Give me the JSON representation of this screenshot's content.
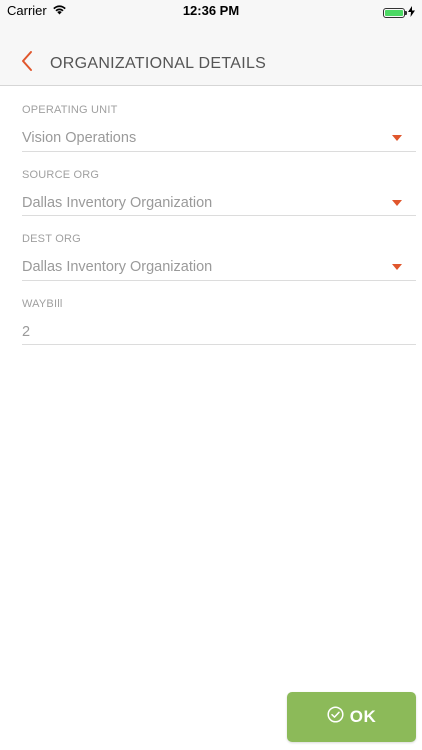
{
  "status_bar": {
    "carrier": "Carrier",
    "time": "12:36 PM",
    "icons": [
      "wifi-icon",
      "battery-icon",
      "charging-bolt-icon"
    ],
    "battery_level": 1.0
  },
  "header": {
    "title": "ORGANIZATIONAL DETAILS",
    "back_icon": "chevron-left-icon"
  },
  "form": {
    "operating_unit": {
      "label": "OPERATING UNIT",
      "value": "Vision Operations"
    },
    "source_org": {
      "label": "SOURCE ORG",
      "value": "Dallas Inventory Organization"
    },
    "dest_org": {
      "label": "DEST ORG",
      "value": "Dallas Inventory Organization"
    },
    "waybill": {
      "label": "WAYBIll",
      "value": "2"
    }
  },
  "actions": {
    "ok_label": "OK",
    "ok_icon": "check-circle-icon"
  },
  "colors": {
    "accent": "#e0562c",
    "ok_button": "#8cba59",
    "battery": "#4cd964"
  }
}
